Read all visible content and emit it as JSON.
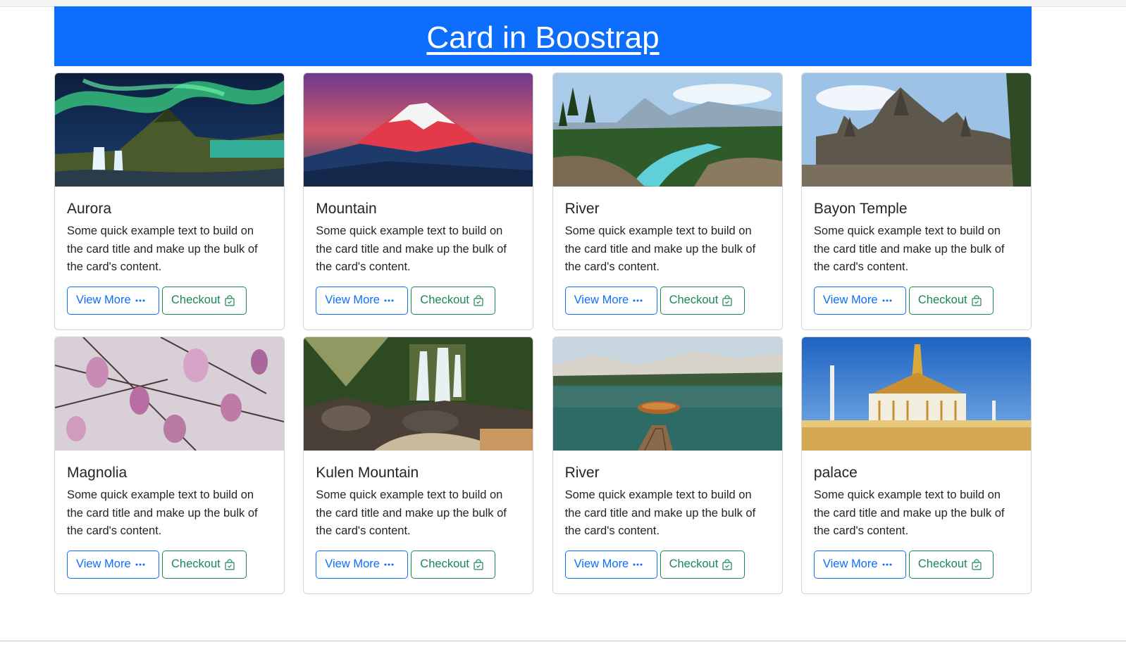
{
  "header": {
    "title": "Card in Boostrap"
  },
  "colors": {
    "primary": "#0d6efd",
    "success": "#198754"
  },
  "cards": [
    {
      "title": "Aurora",
      "text": "Some quick example text to build on the card title and make up the bulk of the card's content.",
      "view_label": "View More",
      "checkout_label": "Checkout",
      "image": "aurora-waterfall-mountain"
    },
    {
      "title": "Mountain",
      "text": "Some quick example text to build on the card title and make up the bulk of the card's content.",
      "view_label": "View More",
      "checkout_label": "Checkout",
      "image": "snow-mountain-sunset"
    },
    {
      "title": "River",
      "text": "Some quick example text to build on the card title and make up the bulk of the card's content.",
      "view_label": "View More",
      "checkout_label": "Checkout",
      "image": "forest-river"
    },
    {
      "title": "Bayon Temple",
      "text": "Some quick example text to build on the card title and make up the bulk of the card's content.",
      "view_label": "View More",
      "checkout_label": "Checkout",
      "image": "stone-temple"
    },
    {
      "title": "Magnolia",
      "text": "Some quick example text to build on the card title and make up the bulk of the card's content.",
      "view_label": "View More",
      "checkout_label": "Checkout",
      "image": "magnolia-blossoms"
    },
    {
      "title": "Kulen Mountain",
      "text": "Some quick example text to build on the card title and make up the bulk of the card's content.",
      "view_label": "View More",
      "checkout_label": "Checkout",
      "image": "jungle-waterfall"
    },
    {
      "title": "River",
      "text": "Some quick example text to build on the card title and make up the bulk of the card's content.",
      "view_label": "View More",
      "checkout_label": "Checkout",
      "image": "lake-boat-dock"
    },
    {
      "title": "palace",
      "text": "Some quick example text to build on the card title and make up the bulk of the card's content.",
      "view_label": "View More",
      "checkout_label": "Checkout",
      "image": "royal-palace"
    }
  ]
}
